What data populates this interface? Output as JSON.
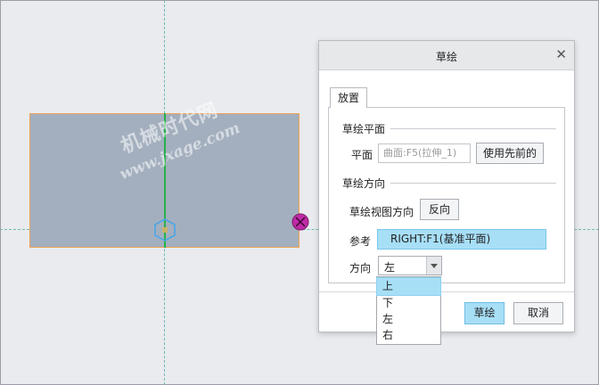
{
  "watermark": {
    "line1": "机械时代网",
    "line2": "www.jxage.com"
  },
  "dialog": {
    "title": "草绘",
    "tab_label": "放置",
    "sketch_plane": {
      "section_label": "草绘平面",
      "plane_label": "平面",
      "plane_value": "曲面:F5(拉伸_1)",
      "use_previous_button": "使用先前的"
    },
    "sketch_orientation": {
      "section_label": "草绘方向",
      "view_direction_label": "草绘视图方向",
      "flip_button": "反向",
      "reference_label": "参考",
      "reference_value": "RIGHT:F1(基准平面)",
      "orientation_label": "方向",
      "orientation_value": "左",
      "orientation_options": [
        "上",
        "下",
        "左",
        "右"
      ],
      "highlighted_option": "上"
    },
    "ok_button": "草绘",
    "cancel_button": "取消"
  },
  "colors": {
    "plane_fill": "#a3afbe",
    "plane_edge": "#f0a254",
    "axis_green": "#26b24a",
    "highlight_blue": "#a7dff7",
    "endpoint_magenta": "#c02aa6"
  }
}
